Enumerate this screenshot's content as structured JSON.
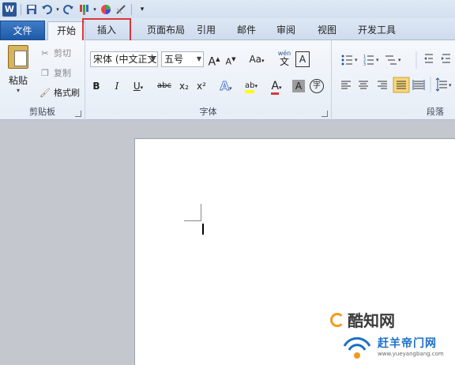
{
  "qat": {
    "app_logo": "W",
    "icons": [
      "save-icon",
      "undo-icon",
      "redo-icon",
      "format-painter-icon",
      "color-wheel-icon",
      "draw-icon",
      "customize-icon"
    ]
  },
  "tabs": [
    {
      "id": "file",
      "label": "文件"
    },
    {
      "id": "home",
      "label": "开始"
    },
    {
      "id": "insert",
      "label": "插入"
    },
    {
      "id": "layout",
      "label": "页面布局"
    },
    {
      "id": "refs",
      "label": "引用"
    },
    {
      "id": "mail",
      "label": "邮件"
    },
    {
      "id": "review",
      "label": "审阅"
    },
    {
      "id": "view",
      "label": "视图"
    },
    {
      "id": "dev",
      "label": "开发工具"
    }
  ],
  "clipboard": {
    "paste": "粘贴",
    "cut": "剪切",
    "copy": "复制",
    "format_painter": "格式刷",
    "group_label": "剪贴板"
  },
  "font": {
    "font_name": "宋体 (中文正文",
    "font_size": "五号",
    "grow": "A",
    "shrink": "A",
    "change_case": "Aa",
    "phonetic": "wén",
    "char_border": "A",
    "bold": "B",
    "italic": "I",
    "underline": "U",
    "strike": "abc",
    "subscript": "x₂",
    "superscript": "x²",
    "text_effects": "A",
    "highlight": "ab",
    "font_color": "A",
    "char_shading": "A",
    "enclose": "字",
    "group_label": "字体"
  },
  "paragraph": {
    "group_label": "段落"
  },
  "colors": {
    "accent": "#2b5797",
    "highlight_box": "#d9383a",
    "highlight_yellow": "#ffff00",
    "font_red": "#d9383a"
  },
  "watermark": {
    "brand1": "酷知网",
    "brand2": "赶羊帝门网",
    "url": "www.yueyangbang.com"
  }
}
